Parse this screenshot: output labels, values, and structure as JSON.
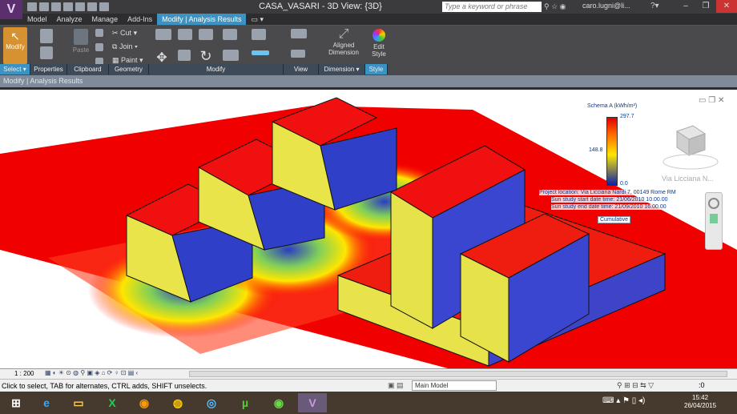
{
  "app": {
    "title": "CASA_VASARI - 3D View: {3D}",
    "logo_letter": "V"
  },
  "search": {
    "placeholder": "Type a keyword or phrase"
  },
  "user": {
    "name": "caro.lugni@li..."
  },
  "tabs": [
    "Model",
    "Analyze",
    "Manage",
    "Add-Ins",
    "Modify | Analysis Results"
  ],
  "ribbon": {
    "modify": "Modify",
    "paste": "Paste",
    "cut": "Cut",
    "join": "Join",
    "paint": "Paint",
    "aligned_dimension": "Aligned Dimension",
    "edit_style": "Edit Style",
    "panels": [
      "Select ▾",
      "Properties",
      "Clipboard",
      "Geometry",
      "Modify",
      "View",
      "Dimension ▾",
      "Style"
    ]
  },
  "option_bar": {
    "text": "Modify | Analysis Results"
  },
  "legend": {
    "title": "Schema A (kWh/m²)",
    "max": "297.7",
    "mid": "148.8",
    "min": "0.0",
    "color_top": "#e00000",
    "color_mid": "#ffe600",
    "color_bottom": "#0a21a8"
  },
  "project": {
    "location": "Project location: Via Licciana Nardi 7, 00149 Rome RM",
    "start": "Sun study start date time: 21/06/2010 10.00.00",
    "end": "Sun study end date time: 21/09/2010 16.00.00",
    "mode": "Cumulative"
  },
  "viewcube_label": "Via Licciana N...",
  "view_control": {
    "scale": "1 : 200"
  },
  "status": {
    "text": "Click to select, TAB for alternates, CTRL adds, SHIFT unselects.",
    "workset": "Main Model",
    "selection_count": ":0"
  },
  "clock": {
    "time": "15:42",
    "date": "26/04/2015"
  }
}
